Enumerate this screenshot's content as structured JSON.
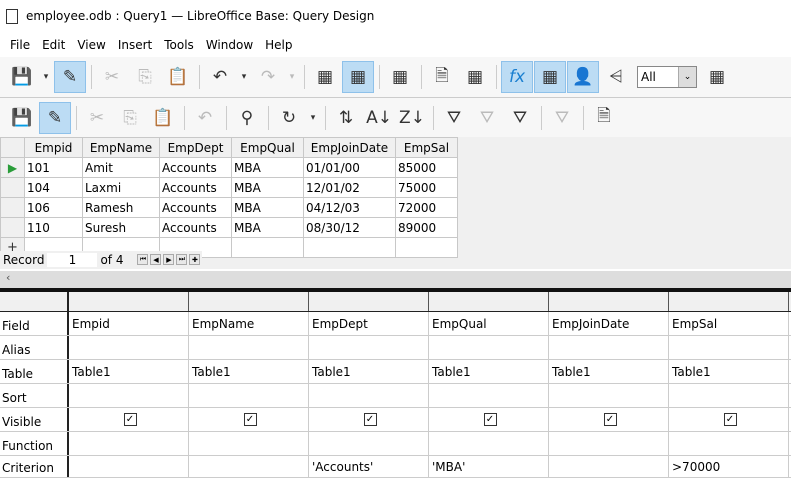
{
  "window": {
    "title": "employee.odb : Query1 — LibreOffice Base: Query Design"
  },
  "menu": [
    "File",
    "Edit",
    "View",
    "Insert",
    "Tools",
    "Window",
    "Help"
  ],
  "toolbar1": [
    {
      "icon": "save-icon",
      "g": "💾"
    },
    {
      "icon": "dropdown-icon",
      "g": "▾",
      "narrow": true
    },
    {
      "icon": "edit-icon",
      "g": "✎",
      "on": true
    },
    {
      "sep": true
    },
    {
      "icon": "cut-icon",
      "g": "✂",
      "dis": true
    },
    {
      "icon": "copy-icon",
      "g": "⎘",
      "dis": true
    },
    {
      "icon": "paste-icon",
      "g": "📋"
    },
    {
      "sep": true
    },
    {
      "icon": "undo-icon",
      "g": "↶"
    },
    {
      "icon": "dropdown-icon",
      "g": "▾",
      "narrow": true
    },
    {
      "icon": "redo-icon",
      "g": "↷",
      "dis": true
    },
    {
      "icon": "dropdown-icon",
      "g": "▾",
      "narrow": true,
      "dis": true
    },
    {
      "sep": true
    },
    {
      "icon": "run-query-icon",
      "g": "▦"
    },
    {
      "icon": "clear-query-icon",
      "g": "▦",
      "on": true
    },
    {
      "sep": true
    },
    {
      "icon": "design-view-icon",
      "g": "▦"
    },
    {
      "sep": true
    },
    {
      "icon": "delete-doc-icon",
      "g": "🗎"
    },
    {
      "icon": "add-table-icon",
      "g": "▦"
    },
    {
      "sep": true
    },
    {
      "icon": "functions-icon",
      "g": "fx",
      "on": true
    },
    {
      "icon": "table-names-icon",
      "g": "▦",
      "on": true
    },
    {
      "icon": "alias-icon",
      "g": "👤",
      "on": true
    },
    {
      "icon": "distinct-values-icon",
      "g": "⩤"
    },
    {
      "combo": true
    },
    {
      "icon": "query-properties-icon",
      "g": "▦"
    }
  ],
  "limit_combo": {
    "value": "All"
  },
  "toolbar2": [
    {
      "icon": "save-record-icon",
      "g": "💾",
      "dis": true
    },
    {
      "icon": "edit-data-icon",
      "g": "✎",
      "on": true
    },
    {
      "sep": true
    },
    {
      "icon": "cut-icon",
      "g": "✂",
      "dis": true
    },
    {
      "icon": "copy-icon",
      "g": "⎘",
      "dis": true
    },
    {
      "icon": "paste-icon",
      "g": "📋",
      "dis": true
    },
    {
      "sep": true
    },
    {
      "icon": "undo-icon",
      "g": "↶",
      "dis": true
    },
    {
      "sep": true
    },
    {
      "icon": "find-record-icon",
      "g": "⚲"
    },
    {
      "sep": true
    },
    {
      "icon": "refresh-icon",
      "g": "↻"
    },
    {
      "icon": "dropdown-icon",
      "g": "▾",
      "narrow": true
    },
    {
      "sep": true
    },
    {
      "icon": "sort-icon",
      "g": "⇅"
    },
    {
      "icon": "sort-ascending-icon",
      "g": "A↓"
    },
    {
      "icon": "sort-descending-icon",
      "g": "Z↓"
    },
    {
      "sep": true
    },
    {
      "icon": "autofilter-icon",
      "g": "⛛"
    },
    {
      "icon": "apply-filter-icon",
      "g": "⛛",
      "dis": true
    },
    {
      "icon": "standard-filter-icon",
      "g": "⛛"
    },
    {
      "sep": true
    },
    {
      "icon": "reset-filter-icon",
      "g": "⛛",
      "dis": true
    },
    {
      "sep": true
    },
    {
      "icon": "delete-record-icon",
      "g": "🗎"
    }
  ],
  "result": {
    "columns": [
      "Empid",
      "EmpName",
      "EmpDept",
      "EmpQual",
      "EmpJoinDate",
      "EmpSal"
    ],
    "widths": [
      58,
      77,
      72,
      72,
      92,
      62
    ],
    "rows": [
      [
        "101",
        "Amit",
        "Accounts",
        "MBA",
        "01/01/00",
        "85000"
      ],
      [
        "104",
        "Laxmi",
        "Accounts",
        "MBA",
        "12/01/02",
        "75000"
      ],
      [
        "106",
        "Ramesh",
        "Accounts",
        "MBA",
        "04/12/03",
        "72000"
      ],
      [
        "110",
        "Suresh",
        "Accounts",
        "MBA",
        "08/30/12",
        "89000"
      ]
    ],
    "record_label": "Record",
    "record_current": "1",
    "record_of": "of 4"
  },
  "design": {
    "row_labels": [
      "Field",
      "Alias",
      "Table",
      "Sort",
      "Visible",
      "Function",
      "Criterion"
    ],
    "columns": [
      {
        "Field": "Empid",
        "Alias": "",
        "Table": "Table1",
        "Sort": "",
        "Visible": true,
        "Function": "",
        "Criterion": ""
      },
      {
        "Field": "EmpName",
        "Alias": "",
        "Table": "Table1",
        "Sort": "",
        "Visible": true,
        "Function": "",
        "Criterion": ""
      },
      {
        "Field": "EmpDept",
        "Alias": "",
        "Table": "Table1",
        "Sort": "",
        "Visible": true,
        "Function": "",
        "Criterion": "'Accounts'"
      },
      {
        "Field": "EmpQual",
        "Alias": "",
        "Table": "Table1",
        "Sort": "",
        "Visible": true,
        "Function": "",
        "Criterion": "'MBA'"
      },
      {
        "Field": "EmpJoinDate",
        "Alias": "",
        "Table": "Table1",
        "Sort": "",
        "Visible": true,
        "Function": "",
        "Criterion": ""
      },
      {
        "Field": "EmpSal",
        "Alias": "",
        "Table": "Table1",
        "Sort": "",
        "Visible": true,
        "Function": "",
        "Criterion": ">70000"
      }
    ]
  }
}
